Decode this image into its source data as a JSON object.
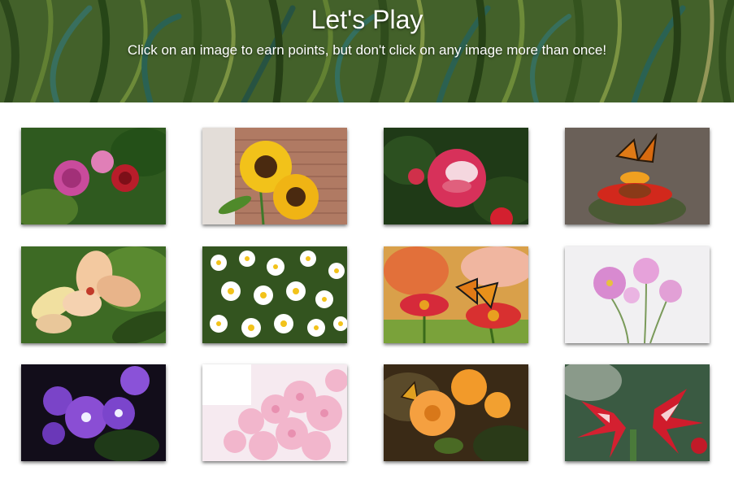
{
  "header": {
    "title": "Let's Play",
    "subtitle": "Click on an image to earn points, but don't click on any image more than once!"
  },
  "cards": [
    {
      "subject": "pink and red roses",
      "background": "#2f5a1f"
    },
    {
      "subject": "sunflowers against brick wall",
      "background": "#b07a63"
    },
    {
      "subject": "pink and white rose",
      "background": "#1f3a17"
    },
    {
      "subject": "butterfly on red flower",
      "background": "#6a6058"
    },
    {
      "subject": "alstroemeria lilies",
      "background": "#3d6a24"
    },
    {
      "subject": "white daisies",
      "background": "#33541f"
    },
    {
      "subject": "butterfly on gerbera flowers",
      "background": "#d9a04a"
    },
    {
      "subject": "pink cosmos flowers",
      "background": "#f1f0f2"
    },
    {
      "subject": "purple geraniums",
      "background": "#120d1a"
    },
    {
      "subject": "pink cherry blossoms",
      "background": "#f6eaf0"
    },
    {
      "subject": "orange flowers with butterfly",
      "background": "#3a2a16"
    },
    {
      "subject": "red amaryllis",
      "background": "#3a5a42"
    }
  ]
}
